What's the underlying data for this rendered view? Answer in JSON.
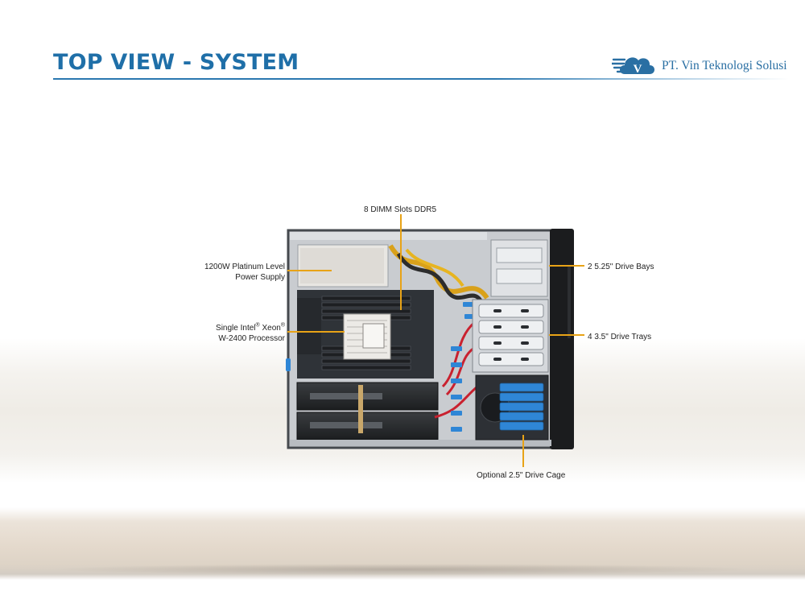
{
  "page": {
    "title": "TOP VIEW - SYSTEM",
    "logo": {
      "mark": "V",
      "text": "PT. Vin Teknologi Solusi"
    }
  },
  "callouts": {
    "dimm": "8 DIMM Slots DDR5",
    "psu": [
      "1200W Platinum Level",
      "Power Supply"
    ],
    "cpu": {
      "line1_a": "Single Intel",
      "line1_sup1": "®",
      "line1_b": " Xeon",
      "line1_sup2": "®",
      "line2": "W-2400 Processor"
    },
    "drive_bays": "2 5.25\" Drive Bays",
    "drive_trays": "4 3.5\" Drive Trays",
    "drive_cage": "Optional 2.5\" Drive Cage"
  },
  "colors": {
    "title": "#1f6fa8",
    "callout_line": "#e8a317",
    "drive_tray_blue": "#2f86d6"
  }
}
